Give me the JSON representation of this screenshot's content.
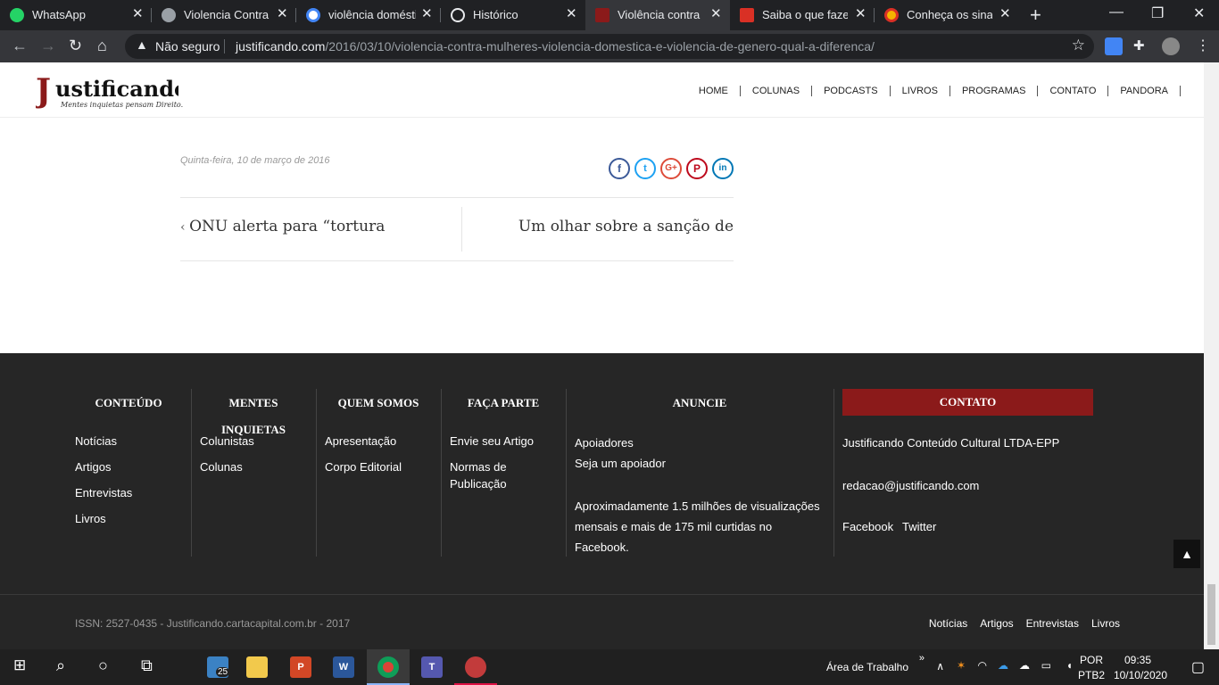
{
  "browser": {
    "tabs": [
      {
        "title": "WhatsApp",
        "icon": "whatsapp-icon"
      },
      {
        "title": "Violencia Contra a",
        "icon": "globe-icon"
      },
      {
        "title": "violência doméstic",
        "icon": "google-icon"
      },
      {
        "title": "Histórico",
        "icon": "history-icon"
      },
      {
        "title": "Violência contra m",
        "icon": "justificando-icon",
        "active": true
      },
      {
        "title": "Saiba o que fazer",
        "icon": "site-icon"
      },
      {
        "title": "Conheça os sinais",
        "icon": "site-icon"
      }
    ],
    "security_label": "Não seguro",
    "url_domain": "justificando.com",
    "url_path": "/2016/03/10/violencia-contra-mulheres-violencia-domestica-e-violencia-de-genero-qual-a-diferenca/"
  },
  "site": {
    "logo_text": "Justificando",
    "logo_tagline": "Mentes inquietas pensam Direito.",
    "nav": [
      "HOME",
      "COLUNAS",
      "PODCASTS",
      "LIVROS",
      "PROGRAMAS",
      "CONTATO",
      "PANDORA"
    ],
    "post_date": "Quinta-feira, 10 de março de 2016",
    "share_icons": [
      "facebook-icon",
      "twitter-icon",
      "google-plus-icon",
      "pinterest-icon",
      "linkedin-icon"
    ],
    "prev_post": "ONU alerta para “tortura",
    "next_post": "Um olhar sobre a sanção de"
  },
  "footer": {
    "conteudo": {
      "title": "CONTEÚDO",
      "items": [
        "Notícias",
        "Artigos",
        "Entrevistas",
        "Livros"
      ]
    },
    "mentes": {
      "title_line1": "MENTES",
      "title_line2": "INQUIETAS",
      "items": [
        "Colunistas",
        "Colunas"
      ]
    },
    "quem": {
      "title": "QUEM SOMOS",
      "items": [
        "Apresentação",
        "Corpo Editorial"
      ]
    },
    "faca": {
      "title": "FAÇA PARTE",
      "items": [
        "Envie seu Artigo",
        "Normas de",
        "Publicação"
      ]
    },
    "anuncie": {
      "title": "ANUNCIE",
      "items": [
        "Apoiadores",
        "Seja um apoiador"
      ],
      "text_lines": [
        "Aproximadamente 1.5 milhões de visualizações",
        "mensais e mais de 175 mil curtidas no",
        "Facebook."
      ]
    },
    "contato": {
      "title": "CONTATO",
      "company": "Justificando Conteúdo Cultural LTDA-EPP",
      "email": "redacao@justificando.com",
      "social": [
        "Facebook",
        "Twitter"
      ]
    },
    "issn": "ISSN: 2527-0435 - Justificando.cartacapital.com.br - 2017",
    "bottom_links": [
      "Notícias",
      "Artigos",
      "Entrevistas",
      "Livros"
    ]
  },
  "taskbar": {
    "desktop_label": "Área de Trabalho",
    "lang": "POR",
    "layout": "PTB2",
    "time": "09:35",
    "date": "10/10/2020",
    "badge": "25"
  },
  "colors": {
    "brand": "#8b1a1a",
    "footer_bg": "#262626",
    "chrome_dark": "#202124"
  }
}
